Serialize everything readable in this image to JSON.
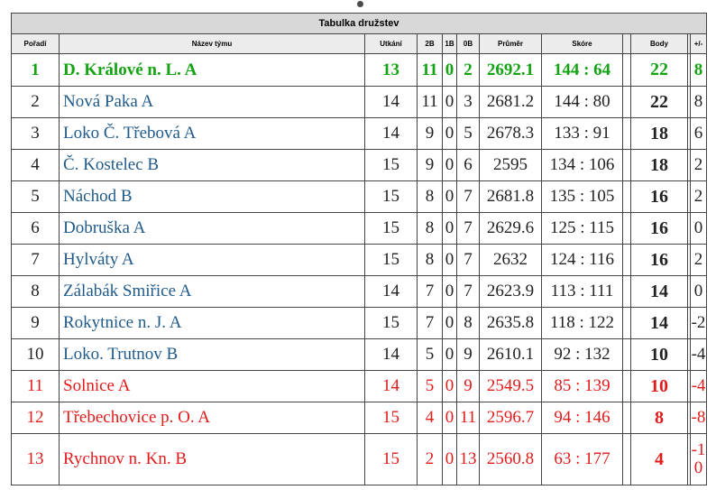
{
  "table": {
    "title": "Tabulka družstev",
    "headers": [
      "Pořadí",
      "Název týmu",
      "Utkání",
      "2B",
      "1B",
      "0B",
      "Průměr",
      "Skóre",
      "",
      "Body",
      "",
      "+/-"
    ],
    "rows": [
      {
        "rank": "1",
        "team": "D. Králové n. L. A",
        "played": "13",
        "w": "11",
        "d": "0",
        "l": "2",
        "avg": "2692.1",
        "score": "144 : 64",
        "points": "22",
        "diff": "8",
        "status": "leader"
      },
      {
        "rank": "2",
        "team": "Nová Paka A",
        "played": "14",
        "w": "11",
        "d": "0",
        "l": "3",
        "avg": "2681.2",
        "score": "144 : 80",
        "points": "22",
        "diff": "8",
        "status": "normal"
      },
      {
        "rank": "3",
        "team": "Loko Č. Třebová A",
        "played": "14",
        "w": "9",
        "d": "0",
        "l": "5",
        "avg": "2678.3",
        "score": "133 : 91",
        "points": "18",
        "diff": "6",
        "status": "normal"
      },
      {
        "rank": "4",
        "team": "Č. Kostelec B",
        "played": "15",
        "w": "9",
        "d": "0",
        "l": "6",
        "avg": "2595",
        "score": "134 : 106",
        "points": "18",
        "diff": "2",
        "status": "normal"
      },
      {
        "rank": "5",
        "team": "Náchod B",
        "played": "15",
        "w": "8",
        "d": "0",
        "l": "7",
        "avg": "2681.8",
        "score": "135 : 105",
        "points": "16",
        "diff": "2",
        "status": "normal"
      },
      {
        "rank": "6",
        "team": "Dobruška A",
        "played": "15",
        "w": "8",
        "d": "0",
        "l": "7",
        "avg": "2629.6",
        "score": "125 : 115",
        "points": "16",
        "diff": "0",
        "status": "normal"
      },
      {
        "rank": "7",
        "team": "Hylváty A",
        "played": "15",
        "w": "8",
        "d": "0",
        "l": "7",
        "avg": "2632",
        "score": "124 : 116",
        "points": "16",
        "diff": "2",
        "status": "normal"
      },
      {
        "rank": "8",
        "team": "Zálabák Smiřice A",
        "played": "14",
        "w": "7",
        "d": "0",
        "l": "7",
        "avg": "2623.9",
        "score": "113 : 111",
        "points": "14",
        "diff": "0",
        "status": "normal"
      },
      {
        "rank": "9",
        "team": "Rokytnice n. J. A",
        "played": "15",
        "w": "7",
        "d": "0",
        "l": "8",
        "avg": "2635.8",
        "score": "118 : 122",
        "points": "14",
        "diff": "-2",
        "status": "normal"
      },
      {
        "rank": "10",
        "team": "Loko. Trutnov B",
        "played": "14",
        "w": "5",
        "d": "0",
        "l": "9",
        "avg": "2610.1",
        "score": "92 : 132",
        "points": "10",
        "diff": "-4",
        "status": "normal"
      },
      {
        "rank": "11",
        "team": "Solnice A",
        "played": "14",
        "w": "5",
        "d": "0",
        "l": "9",
        "avg": "2549.5",
        "score": "85 : 139",
        "points": "10",
        "diff": "-4",
        "status": "relegation"
      },
      {
        "rank": "12",
        "team": "Třebechovice p. O. A",
        "played": "15",
        "w": "4",
        "d": "0",
        "l": "11",
        "avg": "2596.7",
        "score": "94 : 146",
        "points": "8",
        "diff": "-8",
        "status": "relegation"
      },
      {
        "rank": "13",
        "team": "Rychnov n. Kn. B",
        "played": "15",
        "w": "2",
        "d": "0",
        "l": "13",
        "avg": "2560.8",
        "score": "63 : 177",
        "points": "4",
        "diff": "-10",
        "status": "relegation"
      }
    ]
  },
  "colors": {
    "leader": "#13a313",
    "relegation": "#e21b1b",
    "team": "#1f5a8a",
    "header_bg": "#d8d8d8"
  }
}
